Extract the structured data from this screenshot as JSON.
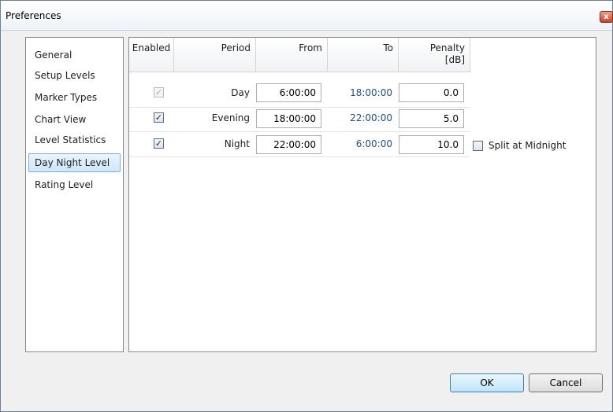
{
  "window": {
    "title": "Preferences",
    "close_glyph": "x"
  },
  "nav": {
    "items": [
      {
        "label": "General",
        "selected": false
      },
      {
        "label": "Setup Levels",
        "selected": false
      },
      {
        "label": "Marker Types",
        "selected": false
      },
      {
        "label": "Chart View",
        "selected": false
      },
      {
        "label": "Level Statistics",
        "selected": false
      },
      {
        "label": "Day Night Level",
        "selected": true
      },
      {
        "label": "Rating Level",
        "selected": false
      }
    ]
  },
  "table": {
    "headers": {
      "enabled": "Enabled",
      "period": "Period",
      "from": "From",
      "to": "To",
      "penalty_line1": "Penalty",
      "penalty_line2": "[dB]"
    },
    "rows": [
      {
        "enabled": true,
        "enabled_editable": false,
        "period": "Day",
        "from": "6:00:00",
        "to": "18:00:00",
        "penalty": "0.0"
      },
      {
        "enabled": true,
        "enabled_editable": true,
        "period": "Evening",
        "from": "18:00:00",
        "to": "22:00:00",
        "penalty": "5.0"
      },
      {
        "enabled": true,
        "enabled_editable": true,
        "period": "Night",
        "from": "22:00:00",
        "to": "6:00:00",
        "penalty": "10.0"
      }
    ]
  },
  "split_at_midnight": {
    "label": "Split at Midnight",
    "checked": false
  },
  "buttons": {
    "ok": "OK",
    "cancel": "Cancel"
  },
  "glyphs": {
    "check": "✓"
  }
}
